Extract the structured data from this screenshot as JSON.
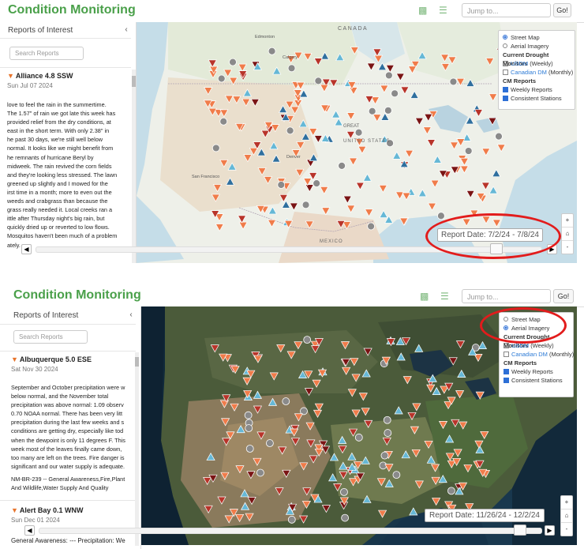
{
  "app_title": "Condition Monitoring",
  "jump_placeholder": "Jump to...",
  "go_label": "Go!",
  "sidebar_title": "Reports of Interest",
  "collapse_glyph": "‹",
  "search_placeholder": "Search Reports",
  "legend": {
    "street_map": "Street Map",
    "aerial_imagery": "Aerial Imagery",
    "drought_heading": "Current Drought Monitors",
    "usdm": "USDM",
    "usdm_freq": "(Weekly)",
    "canadian": "Canadian DM",
    "canadian_freq": "(Monthly)",
    "cm_heading": "CM Reports",
    "weekly_reports": "Weekly Reports",
    "consistent_stations": "Consistent Stations"
  },
  "zoom": {
    "in": "+",
    "home": "⌂",
    "out": "-"
  },
  "map_labels": {
    "canada": "CANADA",
    "united_states": "UNITED STATES",
    "mexico": "MEXICO",
    "great_lakes": "GREAT",
    "edmonton": "Edmonton",
    "calgary": "Calgary",
    "denver": "Denver",
    "san_francisco": "San Francisco"
  },
  "panel1": {
    "report_date": "Report Date: 7/2/24 - 7/8/24",
    "report": {
      "title": "Alliance 4.8 SSW",
      "date": "Sun Jul 07 2024",
      "lines": [
        "love to feel the rain in the summertime.",
        "The 1.57\" of rain we got late this week has",
        "provided relief from the dry conditions, at",
        "east in the short term. With only 2.38\" in",
        "he past 30 days, we're still well below",
        "normal. It looks like we might benefit from",
        "he remnants of hurricane Beryl by",
        "midweek. The rain revived the corn fields",
        "and they're looking less stressed. The lawn",
        "greened up slightly and I mowed for the",
        "irst time in a month; more to even out the",
        "weeds and crabgrass than because the",
        "grass really needed it. Local creeks ran a",
        "ittle after Thursday night's big rain, but",
        "quickly dried up or reverted to low flows.",
        "Mosquitos haven't been much of a problem",
        "ately."
      ]
    },
    "street_map_selected": true
  },
  "panel2": {
    "report_date": "Report Date: 11/26/24 - 12/2/24",
    "report": {
      "title": "Albuquerque 5.0 ESE",
      "date": "Sat Nov 30 2024",
      "lines": [
        "September and October precipitation were w",
        "below normal, and the November total",
        "precipitation was above normal: 1.09 observ",
        "0.70 NOAA normal. There has been very litt",
        "precipitation during the last few weeks and s",
        "conditions are getting dry, especially like tod",
        "when the dewpoint is only 11 degrees F. This",
        "week most of the leaves finally came down, ",
        "too many are left on the trees. Fire danger is",
        "significant and our water supply is adequate."
      ],
      "tags_lines": [
        "NM-BR-239 -- General Awareness,Fire,Plant",
        "And Wildlife,Water Supply And Quality"
      ]
    },
    "report2": {
      "title": "Alert Bay 0.1 WNW",
      "date": "Sun Dec 01 2024",
      "snippet": "General Awareness: --- Precipitation: We"
    },
    "aerial_selected": true
  },
  "colors": {
    "brand_green": "#4aa04a",
    "marker_orange": "#f07c4a",
    "marker_red": "#b8342a",
    "marker_darkred": "#7a1414",
    "marker_blue": "#2f6f9e",
    "marker_lightblue": "#66b8d6",
    "marker_gray": "#8a8a8a",
    "highlight_ring": "#e21c1c"
  }
}
